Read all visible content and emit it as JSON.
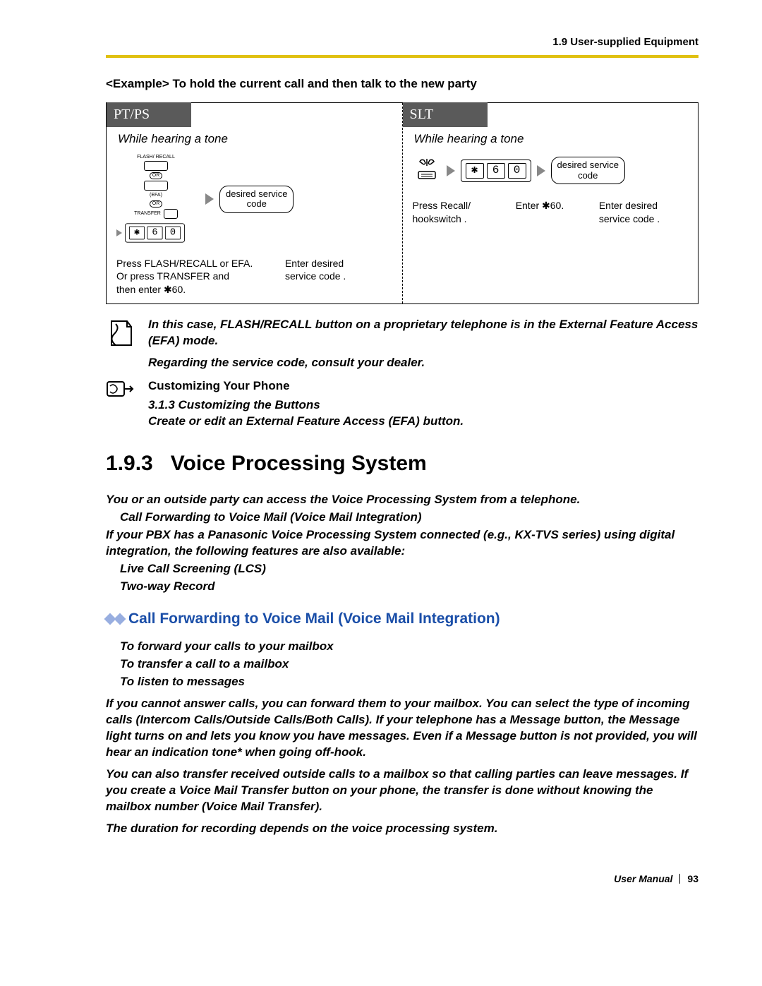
{
  "header": {
    "right": "1.9 User-supplied Equipment"
  },
  "example": {
    "title": "<Example> To hold the current call and then talk to the new party"
  },
  "diagram": {
    "left": {
      "header": "PT/PS",
      "sub": "While hearing a tone",
      "flash_label": "FLASH/\nRECALL",
      "or": "OR",
      "efa": "(EFA)",
      "transfer": "TRANSFER",
      "keys": [
        "✱",
        "6",
        "0"
      ],
      "service": "desired service\ncode",
      "cap1": "Press FLASH/RECALL  or EFA.\nOr press TRANSFER  and\nthen enter ✱60.",
      "cap2": "Enter desired\nservice code  ."
    },
    "right": {
      "header": "SLT",
      "sub": "While hearing a tone",
      "keys": [
        "✱",
        "6",
        "0"
      ],
      "service": "desired service\ncode",
      "cap1": "Press Recall/\nhookswitch  .",
      "cap2": "Enter ✱60.",
      "cap3": "Enter desired\nservice code  ."
    }
  },
  "note": {
    "line1": "In this case, FLASH/RECALL button on a proprietary telephone is in the External Feature Access (EFA) mode.",
    "line2": "Regarding the service code, consult your dealer."
  },
  "customize": {
    "title": "Customizing Your Phone",
    "sub": "3.1.3 Customizing the Buttons",
    "line": "Create or edit an External Feature Access (EFA) button."
  },
  "section": {
    "number": "1.9.3",
    "title": "Voice Processing System",
    "p1": "You or an outside party can access the Voice Processing System from a telephone.",
    "p2": "Call Forwarding to Voice Mail (Voice Mail Integration)",
    "p3": "If your PBX has a Panasonic Voice Processing System connected (e.g., KX-TVS series) using digital integration, the following features are also available:",
    "p4": "Live Call Screening (LCS)",
    "p5": "Two-way Record"
  },
  "vm": {
    "heading": "Call Forwarding to Voice Mail (Voice Mail Integration)",
    "l1": "To forward your calls to your mailbox",
    "l2": "To transfer a call to a mailbox",
    "l3": "To listen to messages",
    "p1": "If you cannot answer calls, you can forward them to your mailbox. You can select the type of incoming calls (Intercom Calls/Outside Calls/Both Calls). If your telephone has a Message button, the Message light turns on and lets you know you have messages. Even if a Message button is not provided, you will hear an indication tone* when going off-hook.",
    "p2": "You can also transfer received outside calls to a mailbox so that calling parties can leave messages. If you create a Voice Mail Transfer button on your phone, the transfer is done without knowing the mailbox number (Voice Mail Transfer).",
    "p3": "The duration for recording depends on the voice processing system."
  },
  "footer": {
    "um": "User Manual",
    "page": "93"
  }
}
